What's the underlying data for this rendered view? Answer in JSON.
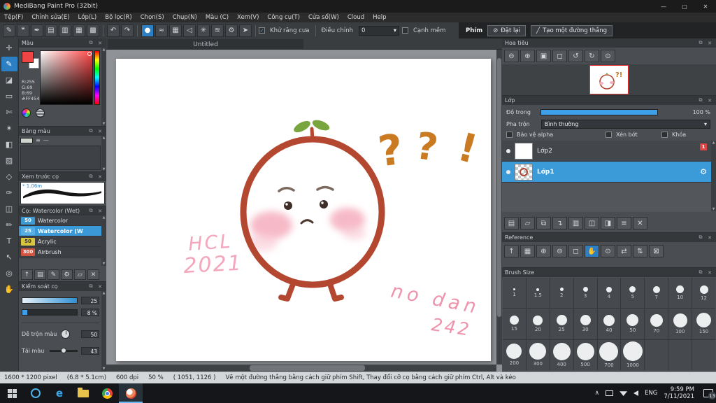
{
  "glyphs": {
    "minimize": "—",
    "maximize": "▢",
    "close": "✕",
    "float": "⧉",
    "panel_close": "✕",
    "caret": "▾",
    "scroll_up": "▲",
    "scroll_down": "▼",
    "check": "✓",
    "undo": "↶",
    "redo": "↷",
    "tray_caret": "∧",
    "menu_lines": "≡",
    "minus": "—"
  },
  "window": {
    "title": "MediBang Paint Pro (32bit)"
  },
  "menubar": {
    "items": [
      "Tệp(F)",
      "Chỉnh sửa(E)",
      "Lớp(L)",
      "Bộ lọc(R)",
      "Chọn(S)",
      "Chụp(N)",
      "Màu (C)",
      "Xem(V)",
      "Công cụ(T)",
      "Cửa sổ(W)",
      "Cloud",
      "Help"
    ]
  },
  "toolbar": {
    "file_icons": [
      {
        "n": "edit-pen-icon",
        "g": "✎"
      },
      {
        "n": "comment-icon",
        "g": "❝"
      },
      {
        "n": "pen-icon",
        "g": "✒"
      },
      {
        "n": "new-page-icon",
        "g": "▤"
      },
      {
        "n": "pages-icon",
        "g": "▥"
      },
      {
        "n": "grid-icon",
        "g": "▦"
      },
      {
        "n": "pixel-grid-icon",
        "g": "▩"
      }
    ],
    "brush_icons": [
      {
        "n": "round-tip-icon",
        "g": "●",
        "active": true
      },
      {
        "n": "scatter-tip-icon",
        "g": "≈"
      },
      {
        "n": "grid-snap-icon",
        "g": "▦"
      },
      {
        "n": "snap-off-icon",
        "g": "◁"
      },
      {
        "n": "radial-snap-icon",
        "g": "✳"
      },
      {
        "n": "curve-snap-icon",
        "g": "≋"
      },
      {
        "n": "snap-settings-icon",
        "g": "⚙"
      },
      {
        "n": "vanish-point-icon",
        "g": "➤"
      }
    ],
    "antialias_label": "Khử răng cưa",
    "adjust_label": "Điều chỉnh",
    "adjust_value": "0",
    "soft_edge_label": "Cạnh mềm",
    "key_label": "Phím",
    "reset_label": "Đặt lại",
    "reset_icon": "⊘",
    "line_label": "Tạo một đường thẳng",
    "line_icon": "╱"
  },
  "left_tools": [
    {
      "n": "move-tool",
      "g": "✛"
    },
    {
      "n": "brush-tool",
      "g": "✎",
      "active": true
    },
    {
      "n": "eraser-tool",
      "g": "◪"
    },
    {
      "n": "rect-select-tool",
      "g": "▭"
    },
    {
      "n": "lasso-tool",
      "g": "✄"
    },
    {
      "n": "magic-wand-tool",
      "g": "✶"
    },
    {
      "n": "bucket-tool",
      "g": "◧"
    },
    {
      "n": "gradient-tool",
      "g": "▨"
    },
    {
      "n": "shape-tool",
      "g": "◇"
    },
    {
      "n": "eyedropper-tool",
      "g": "✑"
    },
    {
      "n": "divide-tool",
      "g": "◫"
    },
    {
      "n": "control-pen-tool",
      "g": "✏"
    },
    {
      "n": "text-tool",
      "g": "T"
    },
    {
      "n": "operation-tool",
      "g": "↖"
    },
    {
      "n": "zoom-tool",
      "g": "◎"
    },
    {
      "n": "hand-tool",
      "g": "✋"
    }
  ],
  "canvas": {
    "tab_title": "Untitled",
    "marks": {
      "q1": "?",
      "q2": "?",
      "bang": "!"
    },
    "writing": {
      "hcl": "HCL",
      "year": "2021",
      "note": "no dan",
      "num": "242"
    }
  },
  "color_panel": {
    "title": "Màu",
    "r": "R:255",
    "g": "G:69",
    "b": "B:69",
    "hex": "#FF4545"
  },
  "palette_panel": {
    "title": "Bảng màu"
  },
  "preview_panel": {
    "title": "Xem trước cọ",
    "size_label": "* 1.06m"
  },
  "brush_panel": {
    "title": "Cọ: Watercolor (Wet)",
    "items": [
      {
        "size": "50",
        "name": "Watercolor",
        "chip": "#3f9ad1",
        "dark": false,
        "selected": false
      },
      {
        "size": "25",
        "name": "Watercolor (W",
        "chip": "#56aee4",
        "dark": false,
        "selected": true
      },
      {
        "size": "50",
        "name": "Acrylic",
        "chip": "#d9c43d",
        "dark": true,
        "selected": false
      },
      {
        "size": "300",
        "name": "Airbrush",
        "chip": "#d2543e",
        "dark": false,
        "selected": false
      }
    ],
    "footer_icons": [
      {
        "n": "add-brush-icon",
        "g": "↑"
      },
      {
        "n": "new-brush-icon",
        "g": "▤"
      },
      {
        "n": "edit-brush-icon",
        "g": "✎"
      },
      {
        "n": "brush-settings-icon",
        "g": "⚙"
      },
      {
        "n": "brush-folder-icon",
        "g": "▱"
      },
      {
        "n": "delete-brush-icon",
        "g": "✕"
      }
    ]
  },
  "control_panel": {
    "title": "Kiểm soát cọ",
    "size_value": "25",
    "opacity_value": "8 %",
    "blend_label": "Dễ trộn màu",
    "blend_value": "50",
    "load_label": "Tải màu",
    "load_value": "43"
  },
  "navigator_panel": {
    "title": "Hoa tiêu",
    "buttons": [
      {
        "n": "zoom-out-icon",
        "g": "⊖"
      },
      {
        "n": "zoom-in-icon",
        "g": "⊕"
      },
      {
        "n": "fit-window-icon",
        "g": "▣"
      },
      {
        "n": "actual-size-icon",
        "g": "◻"
      },
      {
        "n": "rotate-left-icon",
        "g": "↺"
      },
      {
        "n": "rotate-right-icon",
        "g": "↻"
      },
      {
        "n": "reset-view-icon",
        "g": "⊙"
      }
    ]
  },
  "layers_panel": {
    "title": "Lớp",
    "opacity_label": "Độ trong",
    "opacity_value": "100 %",
    "blend_label": "Pha trộn",
    "blend_value": "Bình thường",
    "check1": "Bảo vệ alpha",
    "check2": "Xén bớt",
    "check3": "Khóa",
    "layers": [
      {
        "name": "Lớp2",
        "selected": false,
        "badge": "1"
      },
      {
        "name": "Lớp1",
        "selected": true
      }
    ],
    "footer_icons": [
      {
        "n": "new-layer-icon",
        "g": "▤"
      },
      {
        "n": "new-folder-icon",
        "g": "▱"
      },
      {
        "n": "duplicate-layer-icon",
        "g": "⧉"
      },
      {
        "n": "transfer-layer-icon",
        "g": "↴"
      },
      {
        "n": "merge-layer-icon",
        "g": "▥"
      },
      {
        "n": "combine-layer-icon",
        "g": "◫"
      },
      {
        "n": "mask-layer-icon",
        "g": "◨"
      },
      {
        "n": "layer-menu-icon",
        "g": "≡"
      },
      {
        "n": "delete-layer-icon",
        "g": "✕"
      }
    ]
  },
  "reference_panel": {
    "title": "Reference",
    "buttons": [
      {
        "n": "ref-add-icon",
        "g": "↑"
      },
      {
        "n": "ref-image-icon",
        "g": "▦"
      },
      {
        "n": "ref-zoom-in-icon",
        "g": "⊕"
      },
      {
        "n": "ref-zoom-out-icon",
        "g": "⊖"
      },
      {
        "n": "ref-fit-icon",
        "g": "◻"
      },
      {
        "n": "ref-hand-icon",
        "g": "✋",
        "active": true
      },
      {
        "n": "ref-picker-icon",
        "g": "⊙"
      },
      {
        "n": "ref-flip-h-icon",
        "g": "⇄"
      },
      {
        "n": "ref-flip-v-icon",
        "g": "⇅"
      },
      {
        "n": "ref-lock-icon",
        "g": "⊠"
      }
    ]
  },
  "brush_size_panel": {
    "title": "Brush Size",
    "sizes": [
      "1",
      "1.5",
      "2",
      "3",
      "4",
      "5",
      "7",
      "10",
      "12",
      "15",
      "20",
      "25",
      "30",
      "40",
      "50",
      "70",
      "100",
      "150",
      "200",
      "300",
      "400",
      "500",
      "700",
      "1000"
    ]
  },
  "statusbar": {
    "size": "1600 * 1200 pixel",
    "dims": "(6.8 * 5.1cm)",
    "dpi": "600 dpi",
    "zoom": "50 %",
    "coords": "( 1051, 1126 )",
    "hint": "Vẽ một đường thẳng bằng cách giữ phím Shift, Thay đổi cỡ cọ bằng cách giữ phím Ctrl, Alt và kéo"
  },
  "taskbar": {
    "edge_letter": "e",
    "lang": "ENG",
    "time": "9:59 PM",
    "date": "7/11/2021",
    "badge": "13"
  }
}
